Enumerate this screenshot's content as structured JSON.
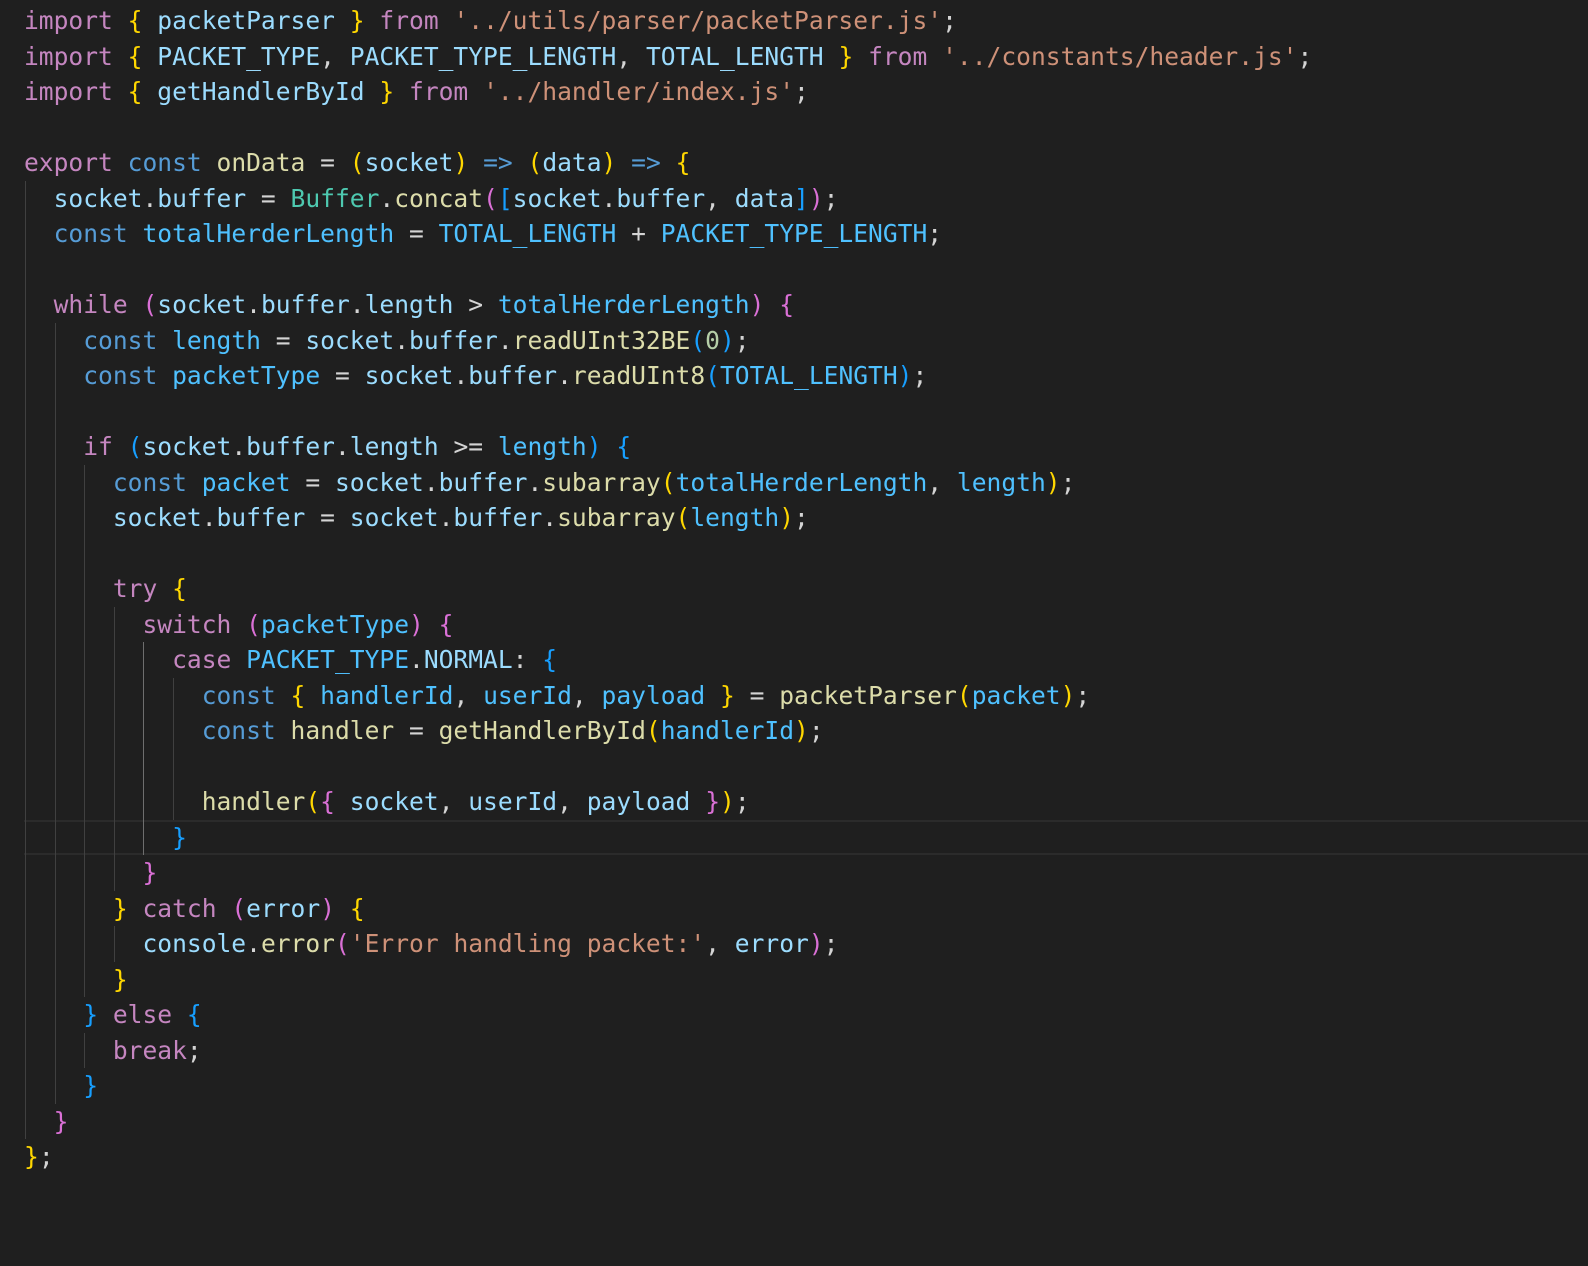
{
  "theme": {
    "background": "#1f1f1f",
    "token_colors": {
      "kw": "#c586c0",
      "sto": "#569cd6",
      "var": "#9cdcfe",
      "cst": "#4fc1ff",
      "fn": "#dcdcaa",
      "cls": "#4ec9b0",
      "str": "#ce9178",
      "num": "#b5cea8",
      "pun": "#d4d4d4",
      "b1": "#ffd700",
      "b2": "#da70d6",
      "b3": "#179fff"
    }
  },
  "editor": {
    "cursor_line": 23,
    "lines": [
      [
        [
          "kw",
          "import"
        ],
        [
          "pun",
          " "
        ],
        [
          "b1",
          "{"
        ],
        [
          "pun",
          " "
        ],
        [
          "var",
          "packetParser"
        ],
        [
          "pun",
          " "
        ],
        [
          "b1",
          "}"
        ],
        [
          "pun",
          " "
        ],
        [
          "kw",
          "from"
        ],
        [
          "pun",
          " "
        ],
        [
          "str",
          "'../utils/parser/packetParser.js'"
        ],
        [
          "pun",
          ";"
        ]
      ],
      [
        [
          "kw",
          "import"
        ],
        [
          "pun",
          " "
        ],
        [
          "b1",
          "{"
        ],
        [
          "pun",
          " "
        ],
        [
          "var",
          "PACKET_TYPE"
        ],
        [
          "pun",
          ", "
        ],
        [
          "var",
          "PACKET_TYPE_LENGTH"
        ],
        [
          "pun",
          ", "
        ],
        [
          "var",
          "TOTAL_LENGTH"
        ],
        [
          "pun",
          " "
        ],
        [
          "b1",
          "}"
        ],
        [
          "pun",
          " "
        ],
        [
          "kw",
          "from"
        ],
        [
          "pun",
          " "
        ],
        [
          "str",
          "'../constants/header.js'"
        ],
        [
          "pun",
          ";"
        ]
      ],
      [
        [
          "kw",
          "import"
        ],
        [
          "pun",
          " "
        ],
        [
          "b1",
          "{"
        ],
        [
          "pun",
          " "
        ],
        [
          "var",
          "getHandlerById"
        ],
        [
          "pun",
          " "
        ],
        [
          "b1",
          "}"
        ],
        [
          "pun",
          " "
        ],
        [
          "kw",
          "from"
        ],
        [
          "pun",
          " "
        ],
        [
          "str",
          "'../handler/index.js'"
        ],
        [
          "pun",
          ";"
        ]
      ],
      [],
      [
        [
          "kw",
          "export"
        ],
        [
          "pun",
          " "
        ],
        [
          "sto",
          "const"
        ],
        [
          "pun",
          " "
        ],
        [
          "fn",
          "onData"
        ],
        [
          "pun",
          " = "
        ],
        [
          "b1",
          "("
        ],
        [
          "var",
          "socket"
        ],
        [
          "b1",
          ")"
        ],
        [
          "pun",
          " "
        ],
        [
          "sto",
          "=>"
        ],
        [
          "pun",
          " "
        ],
        [
          "b1",
          "("
        ],
        [
          "var",
          "data"
        ],
        [
          "b1",
          ")"
        ],
        [
          "pun",
          " "
        ],
        [
          "sto",
          "=>"
        ],
        [
          "pun",
          " "
        ],
        [
          "b1",
          "{"
        ]
      ],
      [
        [
          "pun",
          "  "
        ],
        [
          "var",
          "socket"
        ],
        [
          "pun",
          "."
        ],
        [
          "var",
          "buffer"
        ],
        [
          "pun",
          " = "
        ],
        [
          "cls",
          "Buffer"
        ],
        [
          "pun",
          "."
        ],
        [
          "fn",
          "concat"
        ],
        [
          "b2",
          "("
        ],
        [
          "b3",
          "["
        ],
        [
          "var",
          "socket"
        ],
        [
          "pun",
          "."
        ],
        [
          "var",
          "buffer"
        ],
        [
          "pun",
          ", "
        ],
        [
          "var",
          "data"
        ],
        [
          "b3",
          "]"
        ],
        [
          "b2",
          ")"
        ],
        [
          "pun",
          ";"
        ]
      ],
      [
        [
          "pun",
          "  "
        ],
        [
          "sto",
          "const"
        ],
        [
          "pun",
          " "
        ],
        [
          "cst",
          "totalHerderLength"
        ],
        [
          "pun",
          " = "
        ],
        [
          "cst",
          "TOTAL_LENGTH"
        ],
        [
          "pun",
          " + "
        ],
        [
          "cst",
          "PACKET_TYPE_LENGTH"
        ],
        [
          "pun",
          ";"
        ]
      ],
      [],
      [
        [
          "pun",
          "  "
        ],
        [
          "kw",
          "while"
        ],
        [
          "pun",
          " "
        ],
        [
          "b2",
          "("
        ],
        [
          "var",
          "socket"
        ],
        [
          "pun",
          "."
        ],
        [
          "var",
          "buffer"
        ],
        [
          "pun",
          "."
        ],
        [
          "var",
          "length"
        ],
        [
          "pun",
          " > "
        ],
        [
          "cst",
          "totalHerderLength"
        ],
        [
          "b2",
          ")"
        ],
        [
          "pun",
          " "
        ],
        [
          "b2",
          "{"
        ]
      ],
      [
        [
          "pun",
          "    "
        ],
        [
          "sto",
          "const"
        ],
        [
          "pun",
          " "
        ],
        [
          "cst",
          "length"
        ],
        [
          "pun",
          " = "
        ],
        [
          "var",
          "socket"
        ],
        [
          "pun",
          "."
        ],
        [
          "var",
          "buffer"
        ],
        [
          "pun",
          "."
        ],
        [
          "fn",
          "readUInt32BE"
        ],
        [
          "b3",
          "("
        ],
        [
          "num",
          "0"
        ],
        [
          "b3",
          ")"
        ],
        [
          "pun",
          ";"
        ]
      ],
      [
        [
          "pun",
          "    "
        ],
        [
          "sto",
          "const"
        ],
        [
          "pun",
          " "
        ],
        [
          "cst",
          "packetType"
        ],
        [
          "pun",
          " = "
        ],
        [
          "var",
          "socket"
        ],
        [
          "pun",
          "."
        ],
        [
          "var",
          "buffer"
        ],
        [
          "pun",
          "."
        ],
        [
          "fn",
          "readUInt8"
        ],
        [
          "b3",
          "("
        ],
        [
          "cst",
          "TOTAL_LENGTH"
        ],
        [
          "b3",
          ")"
        ],
        [
          "pun",
          ";"
        ]
      ],
      [],
      [
        [
          "pun",
          "    "
        ],
        [
          "kw",
          "if"
        ],
        [
          "pun",
          " "
        ],
        [
          "b3",
          "("
        ],
        [
          "var",
          "socket"
        ],
        [
          "pun",
          "."
        ],
        [
          "var",
          "buffer"
        ],
        [
          "pun",
          "."
        ],
        [
          "var",
          "length"
        ],
        [
          "pun",
          " >= "
        ],
        [
          "cst",
          "length"
        ],
        [
          "b3",
          ")"
        ],
        [
          "pun",
          " "
        ],
        [
          "b3",
          "{"
        ]
      ],
      [
        [
          "pun",
          "      "
        ],
        [
          "sto",
          "const"
        ],
        [
          "pun",
          " "
        ],
        [
          "cst",
          "packet"
        ],
        [
          "pun",
          " = "
        ],
        [
          "var",
          "socket"
        ],
        [
          "pun",
          "."
        ],
        [
          "var",
          "buffer"
        ],
        [
          "pun",
          "."
        ],
        [
          "fn",
          "subarray"
        ],
        [
          "b1",
          "("
        ],
        [
          "cst",
          "totalHerderLength"
        ],
        [
          "pun",
          ", "
        ],
        [
          "cst",
          "length"
        ],
        [
          "b1",
          ")"
        ],
        [
          "pun",
          ";"
        ]
      ],
      [
        [
          "pun",
          "      "
        ],
        [
          "var",
          "socket"
        ],
        [
          "pun",
          "."
        ],
        [
          "var",
          "buffer"
        ],
        [
          "pun",
          " = "
        ],
        [
          "var",
          "socket"
        ],
        [
          "pun",
          "."
        ],
        [
          "var",
          "buffer"
        ],
        [
          "pun",
          "."
        ],
        [
          "fn",
          "subarray"
        ],
        [
          "b1",
          "("
        ],
        [
          "cst",
          "length"
        ],
        [
          "b1",
          ")"
        ],
        [
          "pun",
          ";"
        ]
      ],
      [],
      [
        [
          "pun",
          "      "
        ],
        [
          "kw",
          "try"
        ],
        [
          "pun",
          " "
        ],
        [
          "b1",
          "{"
        ]
      ],
      [
        [
          "pun",
          "        "
        ],
        [
          "kw",
          "switch"
        ],
        [
          "pun",
          " "
        ],
        [
          "b2",
          "("
        ],
        [
          "cst",
          "packetType"
        ],
        [
          "b2",
          ")"
        ],
        [
          "pun",
          " "
        ],
        [
          "b2",
          "{"
        ]
      ],
      [
        [
          "pun",
          "          "
        ],
        [
          "kw",
          "case"
        ],
        [
          "pun",
          " "
        ],
        [
          "cst",
          "PACKET_TYPE"
        ],
        [
          "pun",
          "."
        ],
        [
          "var",
          "NORMAL"
        ],
        [
          "pun",
          ": "
        ],
        [
          "b3",
          "{"
        ]
      ],
      [
        [
          "pun",
          "            "
        ],
        [
          "sto",
          "const"
        ],
        [
          "pun",
          " "
        ],
        [
          "b1",
          "{"
        ],
        [
          "pun",
          " "
        ],
        [
          "cst",
          "handlerId"
        ],
        [
          "pun",
          ", "
        ],
        [
          "cst",
          "userId"
        ],
        [
          "pun",
          ", "
        ],
        [
          "cst",
          "payload"
        ],
        [
          "pun",
          " "
        ],
        [
          "b1",
          "}"
        ],
        [
          "pun",
          " = "
        ],
        [
          "fn",
          "packetParser"
        ],
        [
          "b1",
          "("
        ],
        [
          "cst",
          "packet"
        ],
        [
          "b1",
          ")"
        ],
        [
          "pun",
          ";"
        ]
      ],
      [
        [
          "pun",
          "            "
        ],
        [
          "sto",
          "const"
        ],
        [
          "pun",
          " "
        ],
        [
          "fn",
          "handler"
        ],
        [
          "pun",
          " = "
        ],
        [
          "fn",
          "getHandlerById"
        ],
        [
          "b1",
          "("
        ],
        [
          "cst",
          "handlerId"
        ],
        [
          "b1",
          ")"
        ],
        [
          "pun",
          ";"
        ]
      ],
      [],
      [
        [
          "pun",
          "            "
        ],
        [
          "fn",
          "handler"
        ],
        [
          "b1",
          "("
        ],
        [
          "b2",
          "{"
        ],
        [
          "pun",
          " "
        ],
        [
          "var",
          "socket"
        ],
        [
          "pun",
          ", "
        ],
        [
          "var",
          "userId"
        ],
        [
          "pun",
          ", "
        ],
        [
          "var",
          "payload"
        ],
        [
          "pun",
          " "
        ],
        [
          "b2",
          "}"
        ],
        [
          "b1",
          ")"
        ],
        [
          "pun",
          ";"
        ]
      ],
      [
        [
          "pun",
          "          "
        ],
        [
          "b3",
          "}"
        ]
      ],
      [
        [
          "pun",
          "        "
        ],
        [
          "b2",
          "}"
        ]
      ],
      [
        [
          "pun",
          "      "
        ],
        [
          "b1",
          "}"
        ],
        [
          "pun",
          " "
        ],
        [
          "kw",
          "catch"
        ],
        [
          "pun",
          " "
        ],
        [
          "b2",
          "("
        ],
        [
          "var",
          "error"
        ],
        [
          "b2",
          ")"
        ],
        [
          "pun",
          " "
        ],
        [
          "b1",
          "{"
        ]
      ],
      [
        [
          "pun",
          "        "
        ],
        [
          "var",
          "console"
        ],
        [
          "pun",
          "."
        ],
        [
          "fn",
          "error"
        ],
        [
          "b2",
          "("
        ],
        [
          "str",
          "'Error handling packet:'"
        ],
        [
          "pun",
          ", "
        ],
        [
          "var",
          "error"
        ],
        [
          "b2",
          ")"
        ],
        [
          "pun",
          ";"
        ]
      ],
      [
        [
          "pun",
          "      "
        ],
        [
          "b1",
          "}"
        ]
      ],
      [
        [
          "pun",
          "    "
        ],
        [
          "b3",
          "}"
        ],
        [
          "pun",
          " "
        ],
        [
          "kw",
          "else"
        ],
        [
          "pun",
          " "
        ],
        [
          "b3",
          "{"
        ]
      ],
      [
        [
          "pun",
          "      "
        ],
        [
          "kw",
          "break"
        ],
        [
          "pun",
          ";"
        ]
      ],
      [
        [
          "pun",
          "    "
        ],
        [
          "b3",
          "}"
        ]
      ],
      [
        [
          "pun",
          "  "
        ],
        [
          "b2",
          "}"
        ]
      ],
      [
        [
          "b1",
          "}"
        ],
        [
          "pun",
          ";"
        ]
      ]
    ]
  }
}
